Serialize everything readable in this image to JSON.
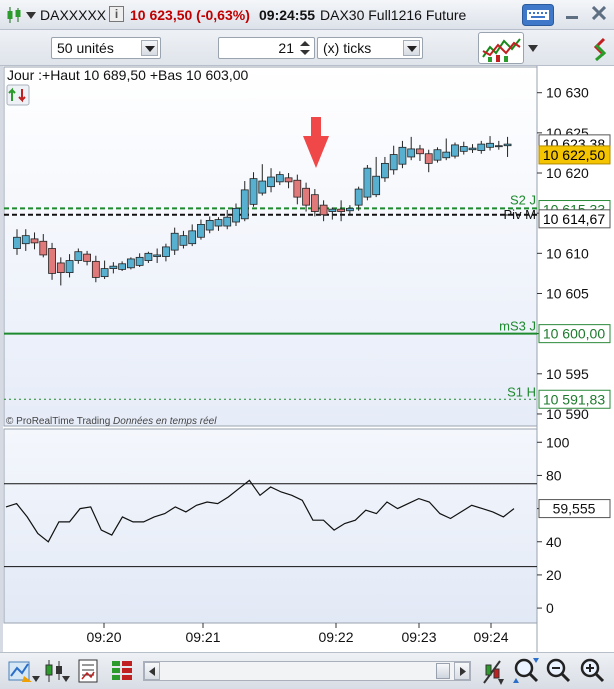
{
  "titlebar": {
    "instrument_code": "DAXXXXX",
    "info_badge": "i",
    "price_change": "10 623,50 (-0,63%)",
    "time": "09:24:55",
    "instrument_name": "DAX30 Full1216 Future",
    "price_color": "#c00000"
  },
  "toolbar": {
    "units_value": "50 unités",
    "ticks_value": "21",
    "ticks_unit": "(x) ticks"
  },
  "chart": {
    "header_text": "Jour :+Haut 10 689,50 +Bas 10 603,00",
    "watermark": "© ProRealTime Trading",
    "watermark_italic": "Données en temps réel",
    "price_ticks": [
      "10 630",
      "10 625",
      "10 620",
      "10 615",
      "10 610",
      "10 605",
      "10 600",
      "10 595",
      "10 590"
    ],
    "price_tick_values": [
      10630,
      10625,
      10620,
      10615,
      10610,
      10605,
      10600,
      10595,
      10590
    ],
    "price_range": [
      10588.5,
      10633.2
    ],
    "badges": [
      {
        "text": "10 623,38",
        "price": 10623.38,
        "bg": "#ffffff",
        "border": "#555555",
        "color": "#000000"
      },
      {
        "text": "10 622,50",
        "price": 10622.5,
        "bg": "#f5c400",
        "border": "#b08a00",
        "color": "#000000"
      },
      {
        "text": "10 615,33",
        "price": 10615.33,
        "bg": "#ffffff",
        "border": "#2a8a3a",
        "color": "#1d7a2d"
      },
      {
        "text": "10 614,67",
        "price": 10614.67,
        "bg": "#ffffff",
        "border": "#555555",
        "color": "#000000"
      },
      {
        "text": "10 600,00",
        "price": 10600.0,
        "bg": "#ffffff",
        "border": "#2a8a3a",
        "color": "#1d7a2d"
      },
      {
        "text": "10 591,83",
        "price": 10591.83,
        "bg": "#ffffff",
        "border": "#2a8a3a",
        "color": "#1d7a2d"
      }
    ],
    "level_labels": [
      {
        "text": "S2 J",
        "price": 10615.6
      },
      {
        "text": "Piv M",
        "price": 10614.8
      },
      {
        "text": "mS3 J",
        "price": 10600.0
      },
      {
        "text": "S1 H",
        "price": 10591.83
      }
    ],
    "time_labels": [
      "09:20",
      "09:21",
      "09:22",
      "09:23",
      "09:24"
    ],
    "indicator_ticks": [
      "100",
      "80",
      "60",
      "40",
      "20",
      "0"
    ],
    "indicator_tick_values": [
      100,
      80,
      60,
      40,
      20,
      0
    ],
    "indicator_value": "59,555",
    "indicator_levels": [
      75,
      25
    ],
    "indicator_range": [
      -9,
      108
    ],
    "colors": {
      "up_candle": "#58b0d0",
      "down_candle": "#e07a7a",
      "indicator_line": "#111111",
      "level_green": "#1d8a2d",
      "level_black": "#111111"
    }
  },
  "chart_data": {
    "type": "candlestick",
    "candles": [
      {
        "o": 10610.6,
        "h": 10613.0,
        "l": 10609.8,
        "c": 10612.0
      },
      {
        "o": 10611.2,
        "h": 10613.0,
        "l": 10610.3,
        "c": 10612.2
      },
      {
        "o": 10611.8,
        "h": 10612.6,
        "l": 10610.5,
        "c": 10611.3
      },
      {
        "o": 10611.5,
        "h": 10612.4,
        "l": 10609.5,
        "c": 10609.8
      },
      {
        "o": 10610.6,
        "h": 10611.3,
        "l": 10606.7,
        "c": 10607.5
      },
      {
        "o": 10608.8,
        "h": 10609.5,
        "l": 10606.0,
        "c": 10607.6
      },
      {
        "o": 10607.6,
        "h": 10609.9,
        "l": 10607.0,
        "c": 10609.1
      },
      {
        "o": 10609.1,
        "h": 10610.6,
        "l": 10608.7,
        "c": 10610.2
      },
      {
        "o": 10609.9,
        "h": 10610.3,
        "l": 10608.5,
        "c": 10609.0
      },
      {
        "o": 10609.0,
        "h": 10609.7,
        "l": 10606.4,
        "c": 10607.0
      },
      {
        "o": 10607.1,
        "h": 10609.1,
        "l": 10606.8,
        "c": 10608.1
      },
      {
        "o": 10608.1,
        "h": 10608.9,
        "l": 10607.5,
        "c": 10608.4
      },
      {
        "o": 10608.0,
        "h": 10609.0,
        "l": 10607.8,
        "c": 10608.7
      },
      {
        "o": 10608.2,
        "h": 10609.5,
        "l": 10608.0,
        "c": 10609.3
      },
      {
        "o": 10608.5,
        "h": 10610.0,
        "l": 10608.3,
        "c": 10609.5
      },
      {
        "o": 10609.1,
        "h": 10610.2,
        "l": 10608.8,
        "c": 10610.0
      },
      {
        "o": 10609.6,
        "h": 10610.6,
        "l": 10608.8,
        "c": 10609.8
      },
      {
        "o": 10609.6,
        "h": 10611.2,
        "l": 10609.0,
        "c": 10610.8
      },
      {
        "o": 10610.4,
        "h": 10613.2,
        "l": 10609.8,
        "c": 10612.5
      },
      {
        "o": 10611.0,
        "h": 10612.8,
        "l": 10610.6,
        "c": 10612.2
      },
      {
        "o": 10611.2,
        "h": 10613.6,
        "l": 10610.9,
        "c": 10612.8
      },
      {
        "o": 10612.0,
        "h": 10614.2,
        "l": 10611.7,
        "c": 10613.6
      },
      {
        "o": 10612.9,
        "h": 10614.6,
        "l": 10612.5,
        "c": 10614.1
      },
      {
        "o": 10613.4,
        "h": 10614.5,
        "l": 10612.8,
        "c": 10614.2
      },
      {
        "o": 10613.4,
        "h": 10615.4,
        "l": 10613.0,
        "c": 10614.5
      },
      {
        "o": 10613.9,
        "h": 10616.2,
        "l": 10613.4,
        "c": 10615.6
      },
      {
        "o": 10614.3,
        "h": 10619.0,
        "l": 10614.0,
        "c": 10617.9
      },
      {
        "o": 10616.1,
        "h": 10620.1,
        "l": 10615.8,
        "c": 10619.3
      },
      {
        "o": 10617.5,
        "h": 10621.1,
        "l": 10617.2,
        "c": 10619.0
      },
      {
        "o": 10618.3,
        "h": 10620.6,
        "l": 10617.6,
        "c": 10619.5
      },
      {
        "o": 10618.9,
        "h": 10620.2,
        "l": 10618.5,
        "c": 10619.8
      },
      {
        "o": 10619.4,
        "h": 10620.0,
        "l": 10618.1,
        "c": 10618.9
      },
      {
        "o": 10619.1,
        "h": 10619.8,
        "l": 10616.1,
        "c": 10617.0
      },
      {
        "o": 10618.1,
        "h": 10618.8,
        "l": 10615.2,
        "c": 10616.0
      },
      {
        "o": 10617.3,
        "h": 10618.0,
        "l": 10614.6,
        "c": 10615.2
      },
      {
        "o": 10616.0,
        "h": 10616.6,
        "l": 10614.0,
        "c": 10614.8
      },
      {
        "o": 10615.2,
        "h": 10615.7,
        "l": 10614.2,
        "c": 10615.5
      },
      {
        "o": 10615.5,
        "h": 10616.6,
        "l": 10614.0,
        "c": 10615.2
      },
      {
        "o": 10615.3,
        "h": 10616.0,
        "l": 10614.8,
        "c": 10615.6
      },
      {
        "o": 10616.0,
        "h": 10618.3,
        "l": 10615.3,
        "c": 10618.0
      },
      {
        "o": 10617.0,
        "h": 10621.0,
        "l": 10616.6,
        "c": 10620.6
      },
      {
        "o": 10617.3,
        "h": 10622.0,
        "l": 10617.0,
        "c": 10619.6
      },
      {
        "o": 10619.4,
        "h": 10622.0,
        "l": 10618.9,
        "c": 10621.2
      },
      {
        "o": 10620.4,
        "h": 10623.4,
        "l": 10619.8,
        "c": 10622.3
      },
      {
        "o": 10621.1,
        "h": 10624.0,
        "l": 10620.6,
        "c": 10623.2
      },
      {
        "o": 10622.0,
        "h": 10624.5,
        "l": 10621.6,
        "c": 10623.0
      },
      {
        "o": 10623.0,
        "h": 10623.5,
        "l": 10621.5,
        "c": 10622.4
      },
      {
        "o": 10622.4,
        "h": 10622.9,
        "l": 10620.1,
        "c": 10621.2
      },
      {
        "o": 10621.6,
        "h": 10623.2,
        "l": 10621.3,
        "c": 10622.9
      },
      {
        "o": 10621.9,
        "h": 10624.3,
        "l": 10621.6,
        "c": 10622.6
      },
      {
        "o": 10622.1,
        "h": 10623.8,
        "l": 10621.8,
        "c": 10623.5
      },
      {
        "o": 10622.7,
        "h": 10623.9,
        "l": 10622.3,
        "c": 10623.3
      },
      {
        "o": 10622.9,
        "h": 10623.6,
        "l": 10622.5,
        "c": 10623.1
      },
      {
        "o": 10622.8,
        "h": 10624.0,
        "l": 10622.4,
        "c": 10623.6
      },
      {
        "o": 10623.2,
        "h": 10624.6,
        "l": 10622.8,
        "c": 10623.7
      },
      {
        "o": 10623.3,
        "h": 10624.0,
        "l": 10622.9,
        "c": 10623.4
      },
      {
        "o": 10623.4,
        "h": 10624.5,
        "l": 10622.0,
        "c": 10623.6
      }
    ],
    "indicator_series": [
      61,
      63,
      55,
      45,
      40,
      52,
      52,
      60,
      61,
      47,
      44,
      55,
      52,
      52,
      55,
      57,
      61,
      58,
      62,
      64,
      63,
      67,
      72,
      77,
      68,
      73,
      70,
      68,
      65,
      53,
      53,
      47,
      51,
      53,
      59,
      57,
      64,
      60,
      63,
      66,
      64,
      57,
      54,
      58,
      62,
      60,
      58,
      55,
      60
    ],
    "price_ylim": [
      10588.5,
      10633.2
    ],
    "indicator_ylim": [
      -9,
      108
    ]
  }
}
